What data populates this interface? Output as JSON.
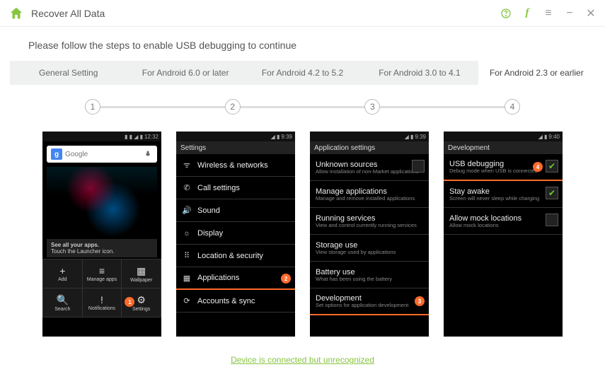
{
  "titlebar": {
    "title": "Recover All Data"
  },
  "instruction": "Please follow the steps to enable USB debugging to continue",
  "tabs": [
    {
      "label": "General Setting",
      "active": false
    },
    {
      "label": "For Android 6.0 or later",
      "active": false
    },
    {
      "label": "For Android 4.2 to 5.2",
      "active": false
    },
    {
      "label": "For Android 3.0 to 4.1",
      "active": false
    },
    {
      "label": "For Android 2.3 or earlier",
      "active": true
    }
  ],
  "steps": [
    "1",
    "2",
    "3",
    "4"
  ],
  "phones": {
    "p1": {
      "time": "12:32",
      "google": "Google",
      "hint_title": "See all your apps.",
      "hint_sub": "Touch the Launcher icon.",
      "dock": [
        {
          "icon": "+",
          "label": "Add"
        },
        {
          "icon": "≡",
          "label": "Manage apps"
        },
        {
          "icon": "▦",
          "label": "Wallpaper"
        },
        {
          "icon": "🔍",
          "label": "Search"
        },
        {
          "icon": "!",
          "label": "Notifications"
        },
        {
          "icon": "⚙",
          "label": "Settings",
          "badge": "1"
        }
      ]
    },
    "p2": {
      "time": "9:39",
      "header": "Settings",
      "rows": [
        {
          "icon": "ᯤ",
          "label": "Wireless & networks"
        },
        {
          "icon": "✆",
          "label": "Call settings"
        },
        {
          "icon": "🔊",
          "label": "Sound"
        },
        {
          "icon": "☼",
          "label": "Display"
        },
        {
          "icon": "⠿",
          "label": "Location & security"
        },
        {
          "icon": "▦",
          "label": "Applications",
          "badge": "2",
          "hl": true
        },
        {
          "icon": "⟳",
          "label": "Accounts & sync"
        }
      ]
    },
    "p3": {
      "time": "9:39",
      "header": "Application settings",
      "rows": [
        {
          "label": "Unknown sources",
          "sub": "Allow installation of non-Market applications",
          "checkbox": true
        },
        {
          "label": "Manage applications",
          "sub": "Manage and remove installed applications"
        },
        {
          "label": "Running services",
          "sub": "View and control currently running services"
        },
        {
          "label": "Storage use",
          "sub": "View storage used by applications"
        },
        {
          "label": "Battery use",
          "sub": "What has been using the battery"
        },
        {
          "label": "Development",
          "sub": "Set options for application development",
          "badge": "3",
          "hl": true
        }
      ]
    },
    "p4": {
      "time": "9:40",
      "header": "Development",
      "rows": [
        {
          "label": "USB debugging",
          "sub": "Debug mode when USB is connected",
          "checkbox": true,
          "checked": true,
          "badge": "4",
          "hl": true
        },
        {
          "label": "Stay awake",
          "sub": "Screen will never sleep while charging",
          "checkbox": true,
          "checked": true
        },
        {
          "label": "Allow mock locations",
          "sub": "Allow mock locations",
          "checkbox": true
        }
      ]
    }
  },
  "footer": {
    "link": "Device is connected but unrecognized"
  }
}
